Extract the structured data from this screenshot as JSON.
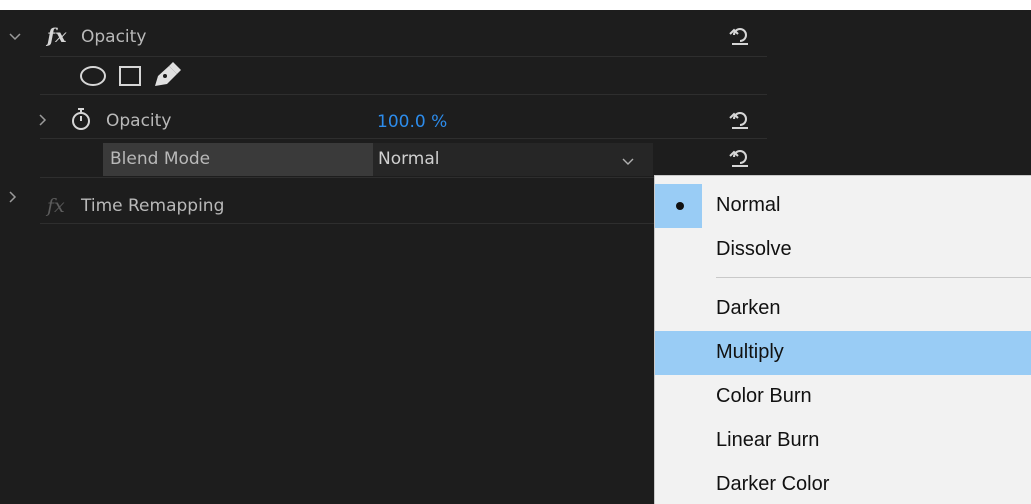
{
  "effects": {
    "opacity_group": {
      "title": "Opacity",
      "fx_symbol": "fx"
    },
    "opacity_property": {
      "label": "Opacity",
      "value": "100.0 %"
    },
    "blend_mode": {
      "label": "Blend Mode",
      "selected": "Normal"
    },
    "time_remapping": {
      "title": "Time Remapping",
      "fx_symbol": "fx"
    }
  },
  "dropdown": {
    "items": [
      {
        "label": "Normal",
        "selected": true
      },
      {
        "label": "Dissolve"
      },
      {
        "label": "Darken"
      },
      {
        "label": "Multiply",
        "hovered": true
      },
      {
        "label": "Color Burn"
      },
      {
        "label": "Linear Burn"
      },
      {
        "label": "Darker Color"
      }
    ]
  },
  "colors": {
    "panel_bg": "#1d1d1d",
    "value_blue": "#2d8ceb",
    "menu_highlight": "#99ccf5",
    "menu_bg": "#f2f2f2"
  },
  "icons": {
    "mask_tools": [
      "ellipse-mask-icon",
      "rectangle-mask-icon",
      "pen-mask-icon"
    ],
    "reset": "reset-icon",
    "stopwatch": "stopwatch-icon"
  }
}
